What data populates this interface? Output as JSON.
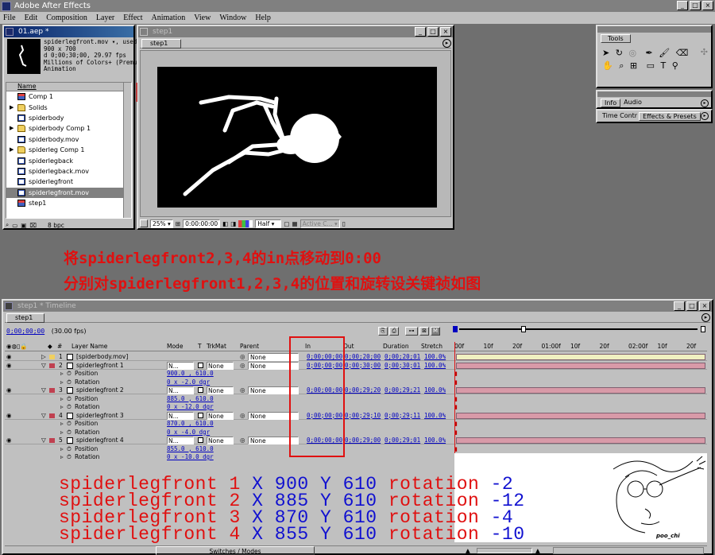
{
  "app": {
    "title": "Adobe After Effects",
    "menu": [
      "File",
      "Edit",
      "Composition",
      "Layer",
      "Effect",
      "Animation",
      "View",
      "Window",
      "Help"
    ]
  },
  "project": {
    "title": "01.aep *",
    "info_name": "spiderlegfront.mov ▾, used",
    "info_lines": [
      "900 x 700",
      "d 0;00;30;00, 29.97 fps",
      "Millions of Colors+ (Premu",
      "Animation"
    ],
    "col_header": "Name",
    "items": [
      {
        "icon": "comp",
        "label": "Comp 1",
        "expand": false
      },
      {
        "icon": "folder",
        "label": "Solids",
        "expand": true
      },
      {
        "icon": "mov",
        "label": "spiderbody",
        "expand": false
      },
      {
        "icon": "folder",
        "label": "spiderbody Comp 1",
        "expand": true
      },
      {
        "icon": "mov",
        "label": "spiderbody.mov",
        "expand": false
      },
      {
        "icon": "folder",
        "label": "spiderleg Comp 1",
        "expand": true
      },
      {
        "icon": "mov",
        "label": "spiderlegback",
        "expand": false
      },
      {
        "icon": "mov",
        "label": "spiderlegback.mov",
        "expand": false
      },
      {
        "icon": "mov",
        "label": "spiderlegfront",
        "expand": false
      },
      {
        "icon": "mov",
        "label": "spiderlegfront.mov",
        "expand": false,
        "selected": true
      },
      {
        "icon": "comp",
        "label": "step1",
        "expand": false
      }
    ],
    "bpc": "8 bpc"
  },
  "comp": {
    "title": "step1",
    "tab": "step1",
    "zoom": "25%",
    "timecode": "0:00:00:00",
    "resolution": "Half",
    "view": "Active C..."
  },
  "tools": {
    "title": "Tools"
  },
  "info_panel": {
    "tabs": [
      "Info",
      "Audio"
    ]
  },
  "time_panel": {
    "tabs": [
      "Time Contr",
      "Effects & Presets"
    ]
  },
  "instructions": {
    "line1": "将spiderlegfront2,3,4的in点移动到0:00",
    "line2": "分别对spiderlegfront1,2,3,4的位置和旋转设关键祯如图"
  },
  "timeline": {
    "title": "step1 * Timeline",
    "tab": "step1",
    "timecode": "0;00;00;00",
    "fps": "(30.00 fps)",
    "headers": {
      "num": "#",
      "layer_name": "Layer Name",
      "mode": "Mode",
      "t": "T",
      "trkmat": "TrkMat",
      "parent": "Parent",
      "in": "In",
      "out": "Out",
      "duration": "Duration",
      "stretch": "Stretch"
    },
    "ruler": [
      "00f",
      "10f",
      "20f",
      "01:00f",
      "10f",
      "20f",
      "02:00f",
      "10f",
      "20f"
    ],
    "layers": [
      {
        "num": "1",
        "name": "[spiderbody.mov]",
        "mode": "",
        "trkmat": "",
        "parent": "None",
        "in": "0;00;00;00",
        "out": "0;00;20;00",
        "duration": "0;00;20;01",
        "stretch": "100.0%",
        "props": []
      },
      {
        "num": "2",
        "name": "spiderlegfront 1",
        "mode": "N...",
        "trkmat": "None",
        "parent": "None",
        "in": "0;00;00;00",
        "out": "0;00;30;00",
        "duration": "0;00;30;01",
        "stretch": "100.0%",
        "props": [
          {
            "name": "Position",
            "value": "900.0 , 610.0"
          },
          {
            "name": "Rotation",
            "value": "0 x -2.0 dgr"
          }
        ]
      },
      {
        "num": "3",
        "name": "spiderlegfront 2",
        "mode": "N...",
        "trkmat": "None",
        "parent": "None",
        "in": "0;00;00;00",
        "out": "0;00;29;20",
        "duration": "0;00;29;21",
        "stretch": "100.0%",
        "props": [
          {
            "name": "Position",
            "value": "885.0 , 610.0"
          },
          {
            "name": "Rotation",
            "value": "0 x -12.0 dgr"
          }
        ]
      },
      {
        "num": "4",
        "name": "spiderlegfront 3",
        "mode": "N...",
        "trkmat": "None",
        "parent": "None",
        "in": "0;00;00;00",
        "out": "0;00;29;10",
        "duration": "0;00;29;11",
        "stretch": "100.0%",
        "props": [
          {
            "name": "Position",
            "value": "870.0 , 610.0"
          },
          {
            "name": "Rotation",
            "value": "0 x -4.0 dgr"
          }
        ]
      },
      {
        "num": "5",
        "name": "spiderlegfront 4",
        "mode": "N...",
        "trkmat": "None",
        "parent": "None",
        "in": "0;00;00;00",
        "out": "0;00;29;00",
        "duration": "0;00;29;01",
        "stretch": "100.0%",
        "props": [
          {
            "name": "Position",
            "value": "855.0 , 610.0"
          },
          {
            "name": "Rotation",
            "value": "0 x -10.0 dgr"
          }
        ]
      }
    ],
    "switches_label": "Switches / Modes",
    "summary": [
      {
        "name": "spiderlegfront 1",
        "x_label": "X",
        "x": "900",
        "y_label": "Y",
        "y": "610",
        "rot_label": "rotation",
        "rot": "-2"
      },
      {
        "name": "spiderlegfront 2",
        "x_label": "X",
        "x": "885",
        "y_label": "Y",
        "y": "610",
        "rot_label": "rotation",
        "rot": "-12"
      },
      {
        "name": "spiderlegfront 3",
        "x_label": "X",
        "x": "870",
        "y_label": "Y",
        "y": "610",
        "rot_label": "rotation",
        "rot": "-4"
      },
      {
        "name": "spiderlegfront 4",
        "x_label": "X",
        "x": "855",
        "y_label": "Y",
        "y": "610",
        "rot_label": "rotation",
        "rot": "-10"
      }
    ],
    "signature": "poo_chi"
  },
  "colors": {
    "highlight_box": "#e01010",
    "layer_bar": "#d89aa8",
    "layer_bar_top": "#f0f0c0",
    "text_red": "#e01010",
    "text_blue": "#1010d0"
  }
}
